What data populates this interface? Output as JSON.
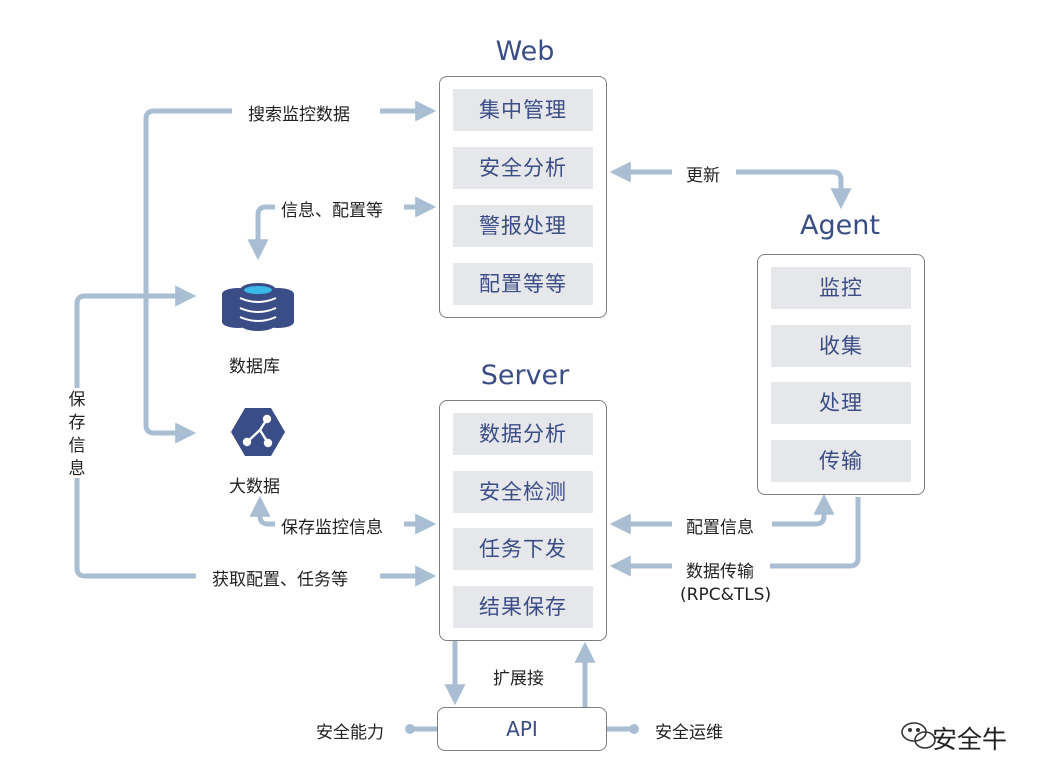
{
  "web": {
    "title": "Web",
    "items": [
      "集中管理",
      "安全分析",
      "警报处理",
      "配置等等"
    ]
  },
  "server": {
    "title": "Server",
    "items": [
      "数据分析",
      "安全检测",
      "任务下发",
      "结果保存"
    ]
  },
  "agent": {
    "title": "Agent",
    "items": [
      "监控",
      "收集",
      "处理",
      "传输"
    ]
  },
  "api": {
    "label": "API"
  },
  "database": {
    "label": "数据库"
  },
  "bigdata": {
    "label": "大数据"
  },
  "edges": {
    "search_monitor_data": "搜索监控数据",
    "info_config": "信息、配置等",
    "update": "更新",
    "save_info": "保存信息",
    "save_monitor_info": "保存监控信息",
    "get_config_tasks": "获取配置、任务等",
    "config_info": "配置信息",
    "data_transfer": "数据传输",
    "data_transfer_protocol": "(RPC&TLS)",
    "extension": "扩展接",
    "security_capability": "安全能力",
    "security_ops": "安全运维"
  },
  "watermark": {
    "text": "安全牛"
  },
  "colors": {
    "arrow": "#a9bdd3",
    "title": "#3a4d86",
    "box_border": "#7d7d7d",
    "item_fill": "#e6e7ea",
    "icon_fill": "#3a4d86"
  }
}
